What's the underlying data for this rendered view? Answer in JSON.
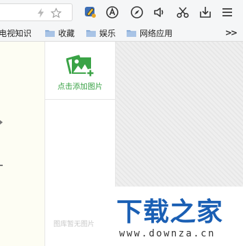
{
  "toolbar": {
    "icons": [
      "lightning-icon",
      "star-icon",
      "paint-brush-icon",
      "adblock-icon",
      "compass-icon",
      "speaker-icon",
      "scissors-icon",
      "download-icon",
      "menu-icon"
    ]
  },
  "bookmarks": [
    {
      "label": "电视知识",
      "icon": "folder-icon"
    },
    {
      "label": "收藏",
      "icon": "folder-icon"
    },
    {
      "label": "娱乐",
      "icon": "folder-icon"
    },
    {
      "label": "网络应用",
      "icon": "folder-icon"
    }
  ],
  "bookmarks_more": ">>",
  "gallery": {
    "upload_label": "点击添加图片",
    "empty_label": "图库暂无图片"
  },
  "watermark": {
    "title": "下载之家",
    "url": "www.downza.cn"
  },
  "colors": {
    "accent_green": "#3aa346",
    "watermark_blue": "#1a5fb4"
  }
}
